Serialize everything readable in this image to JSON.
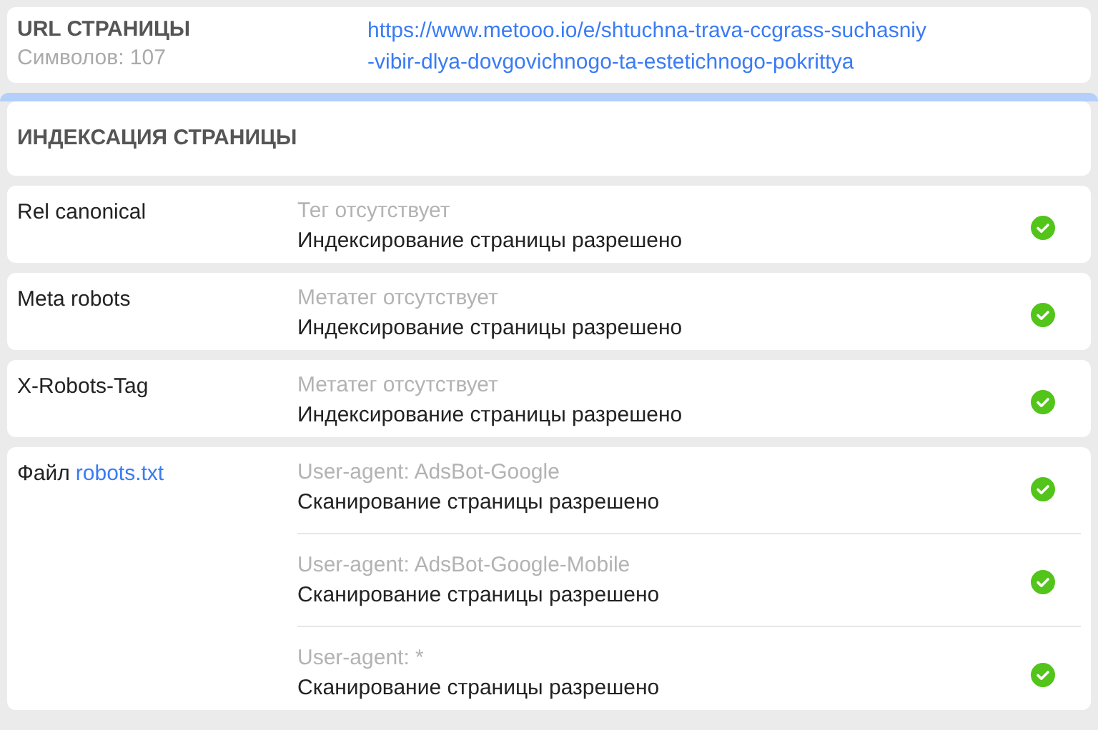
{
  "url_card": {
    "title": "URL СТРАНИЦЫ",
    "count": "Символов: 107",
    "url": "https://www.metooo.io/e/shtuchna-trava-ccgrass-suchasniy-vibir-dlya-dovgovichnogo-ta-estetichnogo-pokrittya"
  },
  "section": {
    "title": "ИНДЕКСАЦИЯ СТРАНИЦЫ"
  },
  "rows": [
    {
      "label": "Rel canonical",
      "entries": [
        {
          "note": "Тег отсутствует",
          "result": "Индексирование страницы разрешено",
          "passed": true
        }
      ]
    },
    {
      "label": "Meta robots",
      "entries": [
        {
          "note": "Метатег отсутствует",
          "result": "Индексирование страницы разрешено",
          "passed": true
        }
      ]
    },
    {
      "label": "X-Robots-Tag",
      "entries": [
        {
          "note": "Метатег отсутствует",
          "result": "Индексирование страницы разрешено",
          "passed": true
        }
      ]
    },
    {
      "label": "Файл",
      "label_link": "robots.txt",
      "entries": [
        {
          "note": "User-agent: AdsBot-Google",
          "result": "Сканирование страницы разрешено",
          "passed": true
        },
        {
          "note": "User-agent: AdsBot-Google-Mobile",
          "result": "Сканирование страницы разрешено",
          "passed": true
        },
        {
          "note": "User-agent: *",
          "result": "Сканирование страницы разрешено",
          "passed": true
        }
      ]
    }
  ]
}
